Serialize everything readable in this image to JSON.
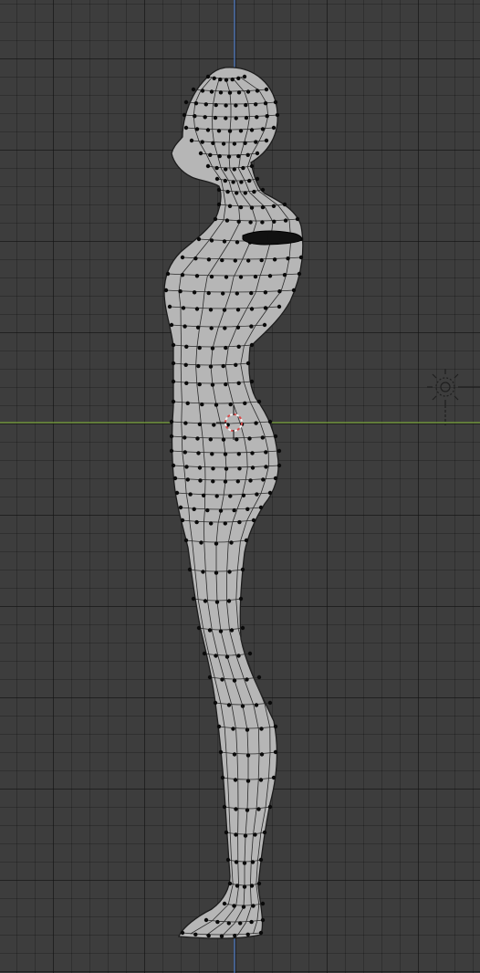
{
  "viewport": {
    "mode": "edit-mode",
    "view": "right-orthographic",
    "selected_element": "arm-bone-cluster"
  },
  "colors": {
    "background": "#3d3d3d",
    "grid_line": "#353535",
    "axis_z": "#4d79c2",
    "axis_y": "#7aa33b",
    "mesh_fill": "#b6b6b6",
    "mesh_wire": "#1c1c1c",
    "vertex": "#0a0a0a",
    "cursor_red": "#d94a4a",
    "cursor_white": "#f2f2f2",
    "light_gizmo": "#1f1f1f"
  },
  "icons": {
    "cursor": "3d-cursor-icon",
    "light": "sun-lamp-icon"
  }
}
